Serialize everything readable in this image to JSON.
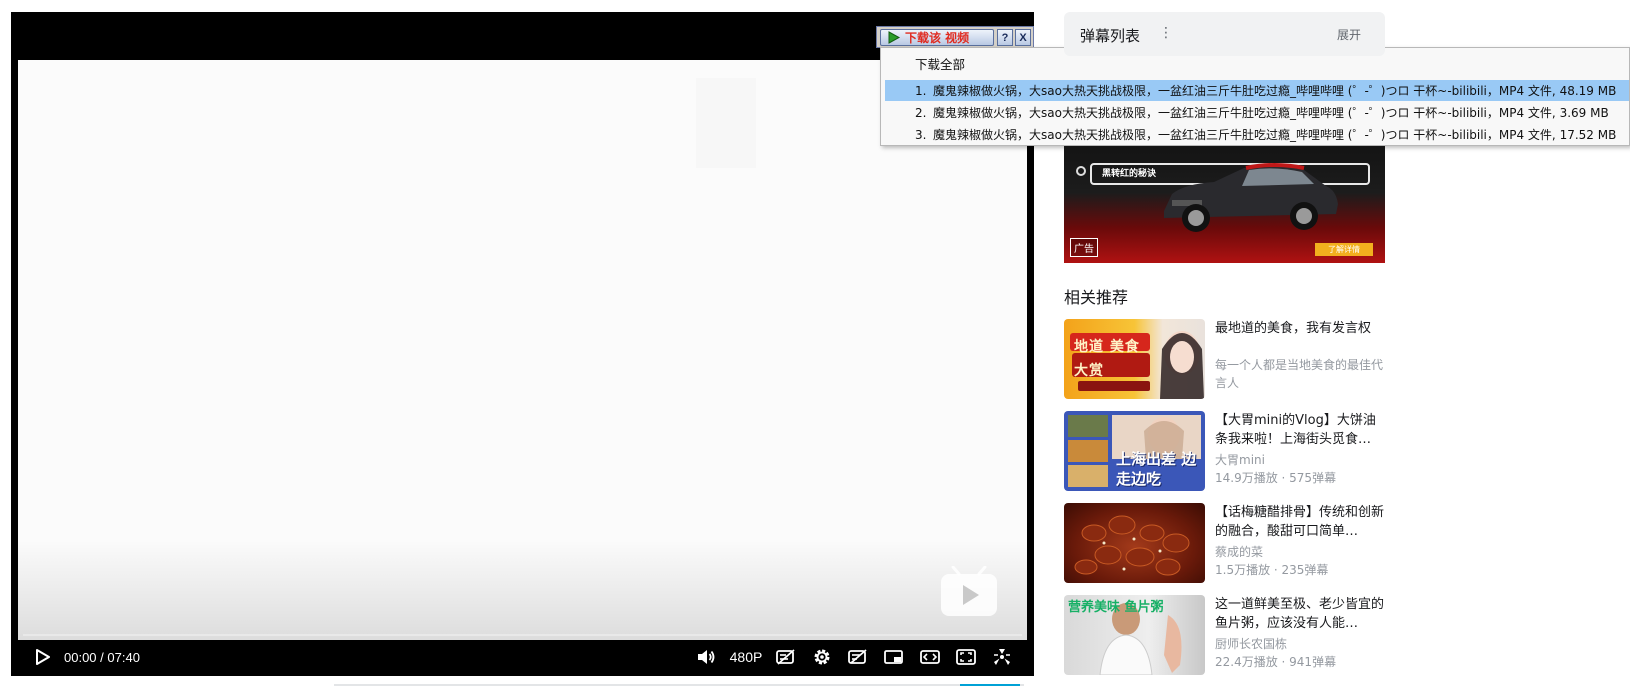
{
  "player": {
    "time_current": "00:00",
    "time_separator": "/",
    "time_total": "07:40",
    "quality": "480P",
    "progress": 0
  },
  "download": {
    "button_label": "下载该 视频",
    "help_label": "?",
    "close_label": "X",
    "all_label": "下载全部",
    "items": [
      {
        "num": "1.",
        "text": "魔鬼辣椒做火锅，大sao大热天挑战极限，一盆红油三斤牛肚吃过瘾_哔哩哔哩 (゜-゜)つロ 干杯~-bilibili，MP4 文件, 48.19 MB"
      },
      {
        "num": "2.",
        "text": "魔鬼辣椒做火锅，大sao大热天挑战极限，一盆红油三斤牛肚吃过瘾_哔哩哔哩 (゜-゜)つロ 干杯~-bilibili，MP4 文件, 3.69 MB"
      },
      {
        "num": "3.",
        "text": "魔鬼辣椒做火锅，大sao大热天挑战极限，一盆红油三斤牛肚吃过瘾_哔哩哔哩 (゜-゜)つロ 干杯~-bilibili，MP4 文件, 17.52 MB"
      }
    ]
  },
  "danmaku": {
    "title": "弹幕列表",
    "more_icon": "⋮",
    "expand": "展开"
  },
  "ad": {
    "search_text": "黑转红的秘诀",
    "tag": "广告",
    "cta": "了解详情"
  },
  "recommend": {
    "title": "相关推荐",
    "items": [
      {
        "name": "最地道的美食，我有发言权",
        "desc": "每一个人都是当地美食的最佳代言人",
        "thumb_text": "地道 美食大赏"
      },
      {
        "name": "【大胃mini的Vlog】大饼油条我来啦！上海街头觅食…",
        "up": "大胃mini",
        "stats": "14.9万播放 · 575弹幕",
        "thumb_text": "上海出差 边走边吃"
      },
      {
        "name": "【话梅糖醋排骨】传统和创新的融合，酸甜可口简单…",
        "up": "蔡成的菜",
        "stats": "1.5万播放 · 235弹幕"
      },
      {
        "name": "这一道鲜美至极、老少皆宜的鱼片粥，应该没有人能…",
        "up": "厨师长农国栋",
        "stats": "22.4万播放 · 941弹幕",
        "thumb_text": "营养美味 鱼片粥"
      }
    ]
  },
  "colors": {
    "accent": "#00a1d6",
    "menu_selected": "#99c9f5"
  }
}
